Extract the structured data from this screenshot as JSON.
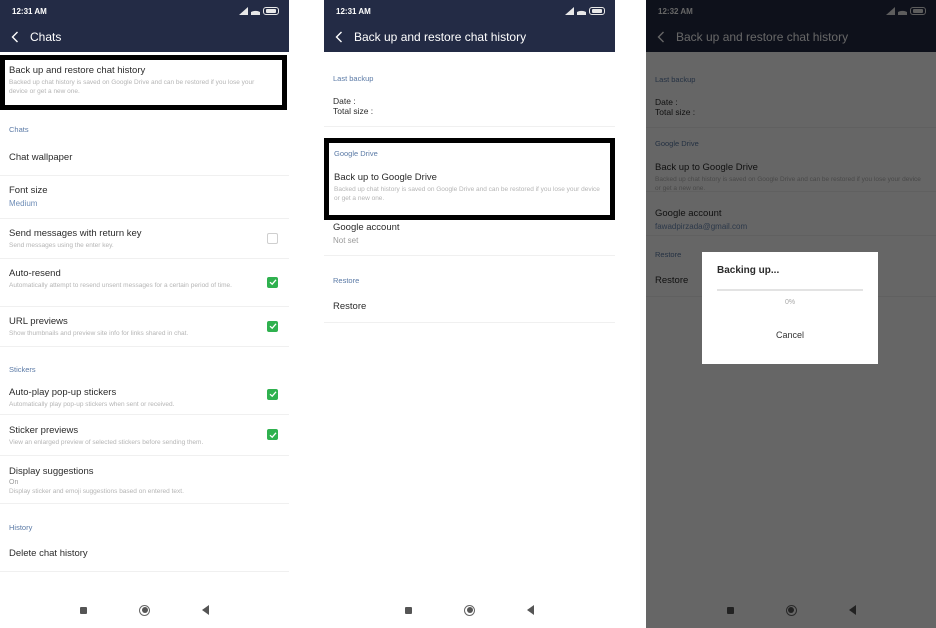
{
  "panels": {
    "chats": {
      "status_time": "12:31 AM",
      "title": "Chats",
      "backup_row": {
        "title": "Back up and restore chat history",
        "subtitle": "Backed up chat history is saved on Google Drive and can be restored if you lose your device or get a new one."
      },
      "sections": {
        "chats_header": "Chats",
        "stickers_header": "Stickers",
        "history_header": "History"
      },
      "items": {
        "chat_wallpaper": {
          "title": "Chat wallpaper"
        },
        "font_size": {
          "title": "Font size",
          "value": "Medium"
        },
        "send_return": {
          "title": "Send messages with return key",
          "subtitle": "Send messages using the enter key.",
          "checked": false
        },
        "auto_resend": {
          "title": "Auto-resend",
          "subtitle": "Automatically attempt to resend unsent messages for a certain period of time.",
          "checked": true
        },
        "url_previews": {
          "title": "URL previews",
          "subtitle": "Show thumbnails and preview site info for links shared in chat.",
          "checked": true
        },
        "autoplay_stickers": {
          "title": "Auto-play pop-up stickers",
          "subtitle": "Automatically play pop-up stickers when sent or received.",
          "checked": true
        },
        "sticker_previews": {
          "title": "Sticker previews",
          "subtitle": "View an enlarged preview of selected stickers before sending them.",
          "checked": true
        },
        "display_suggestions": {
          "title": "Display suggestions",
          "value": "On",
          "subtitle": "Display sticker and emoji suggestions based on entered text."
        },
        "delete_history": {
          "title": "Delete chat history"
        }
      }
    },
    "backup": {
      "status_time": "12:31 AM",
      "title": "Back up and restore chat history",
      "last_backup_header": "Last backup",
      "date_label": "Date :",
      "size_label": "Total size :",
      "google_drive_header": "Google Drive",
      "backup_to_drive": {
        "title": "Back up to Google Drive",
        "subtitle": "Backed up chat history is saved on Google Drive and can be restored if you lose your device or get a new one."
      },
      "google_account": {
        "title": "Google account",
        "value": "Not set"
      },
      "restore_header": "Restore",
      "restore_item": "Restore"
    },
    "backing_up": {
      "status_time": "12:32 AM",
      "title": "Back up and restore chat history",
      "last_backup_header": "Last backup",
      "date_label": "Date :",
      "size_label": "Total size :",
      "google_drive_header": "Google Drive",
      "backup_to_drive": {
        "title": "Back up to Google Drive",
        "subtitle": "Backed up chat history is saved on Google Drive and can be restored if you lose your device or get a new one."
      },
      "google_account": {
        "title": "Google account",
        "value": "fawadpirzada@gmail.com"
      },
      "restore_header": "Restore",
      "restore_item": "Restore",
      "dialog": {
        "title": "Backing up...",
        "progress_percent": 0,
        "progress_label": "0%",
        "cancel_label": "Cancel"
      }
    }
  },
  "colors": {
    "header_bg": "#232b45",
    "accent_green": "#2fb14f",
    "section_blue": "#5b7aa6"
  }
}
